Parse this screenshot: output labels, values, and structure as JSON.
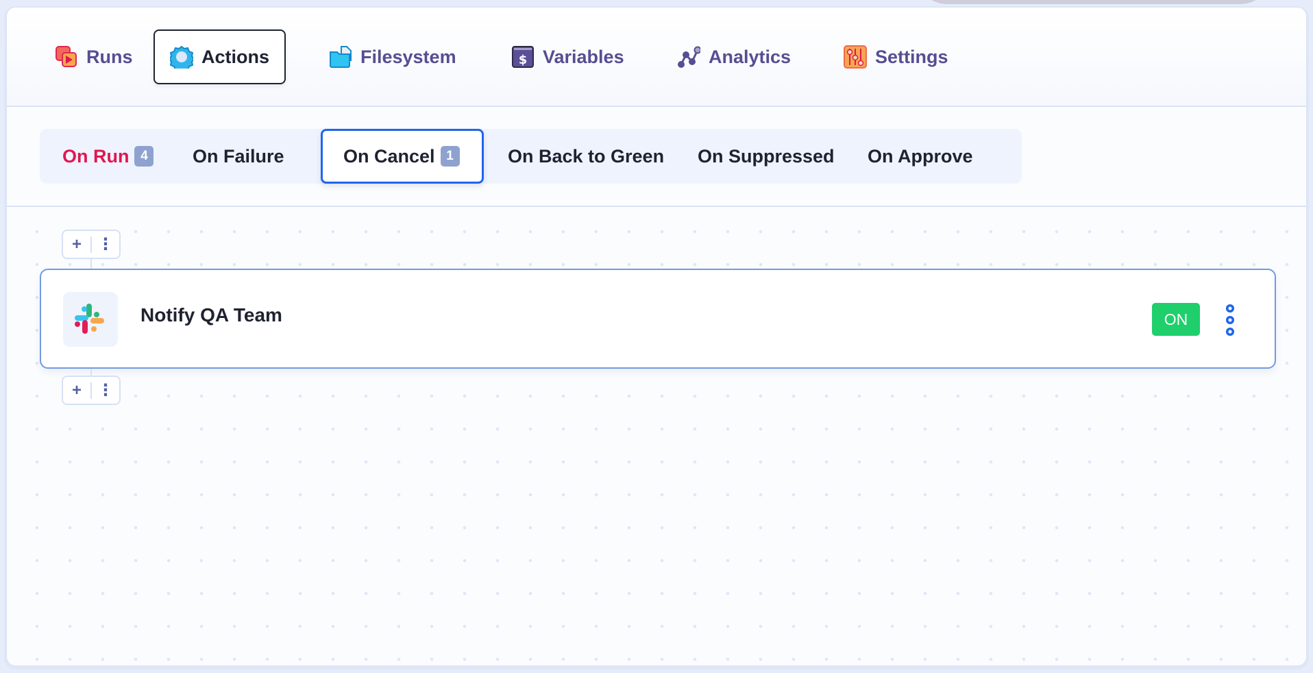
{
  "main_tabs": [
    {
      "label": "Runs",
      "icon": "runs-icon",
      "active": false
    },
    {
      "label": "Actions",
      "icon": "gear-icon",
      "active": true
    },
    {
      "label": "Filesystem",
      "icon": "folder-icon",
      "active": false
    },
    {
      "label": "Variables",
      "icon": "dollar-icon",
      "active": false
    },
    {
      "label": "Analytics",
      "icon": "analytics-icon",
      "active": false
    },
    {
      "label": "Settings",
      "icon": "sliders-icon",
      "active": false
    }
  ],
  "sub_tabs": [
    {
      "label": "On Run",
      "count": "4",
      "highlight": true
    },
    {
      "label": "On Failure"
    },
    {
      "label": "On Cancel",
      "count": "1",
      "active": true
    },
    {
      "label": "On Back to Green"
    },
    {
      "label": "On Suppressed"
    },
    {
      "label": "On Approve"
    }
  ],
  "controls": {
    "add": "+",
    "more": "⋮"
  },
  "action_node": {
    "icon": "slack-icon",
    "title": "Notify QA Team",
    "status": "ON"
  },
  "colors": {
    "accent": "#1e66ee",
    "tab_text": "#564e92",
    "highlight_red": "#e0174f",
    "status_on": "#1fcf6c"
  }
}
